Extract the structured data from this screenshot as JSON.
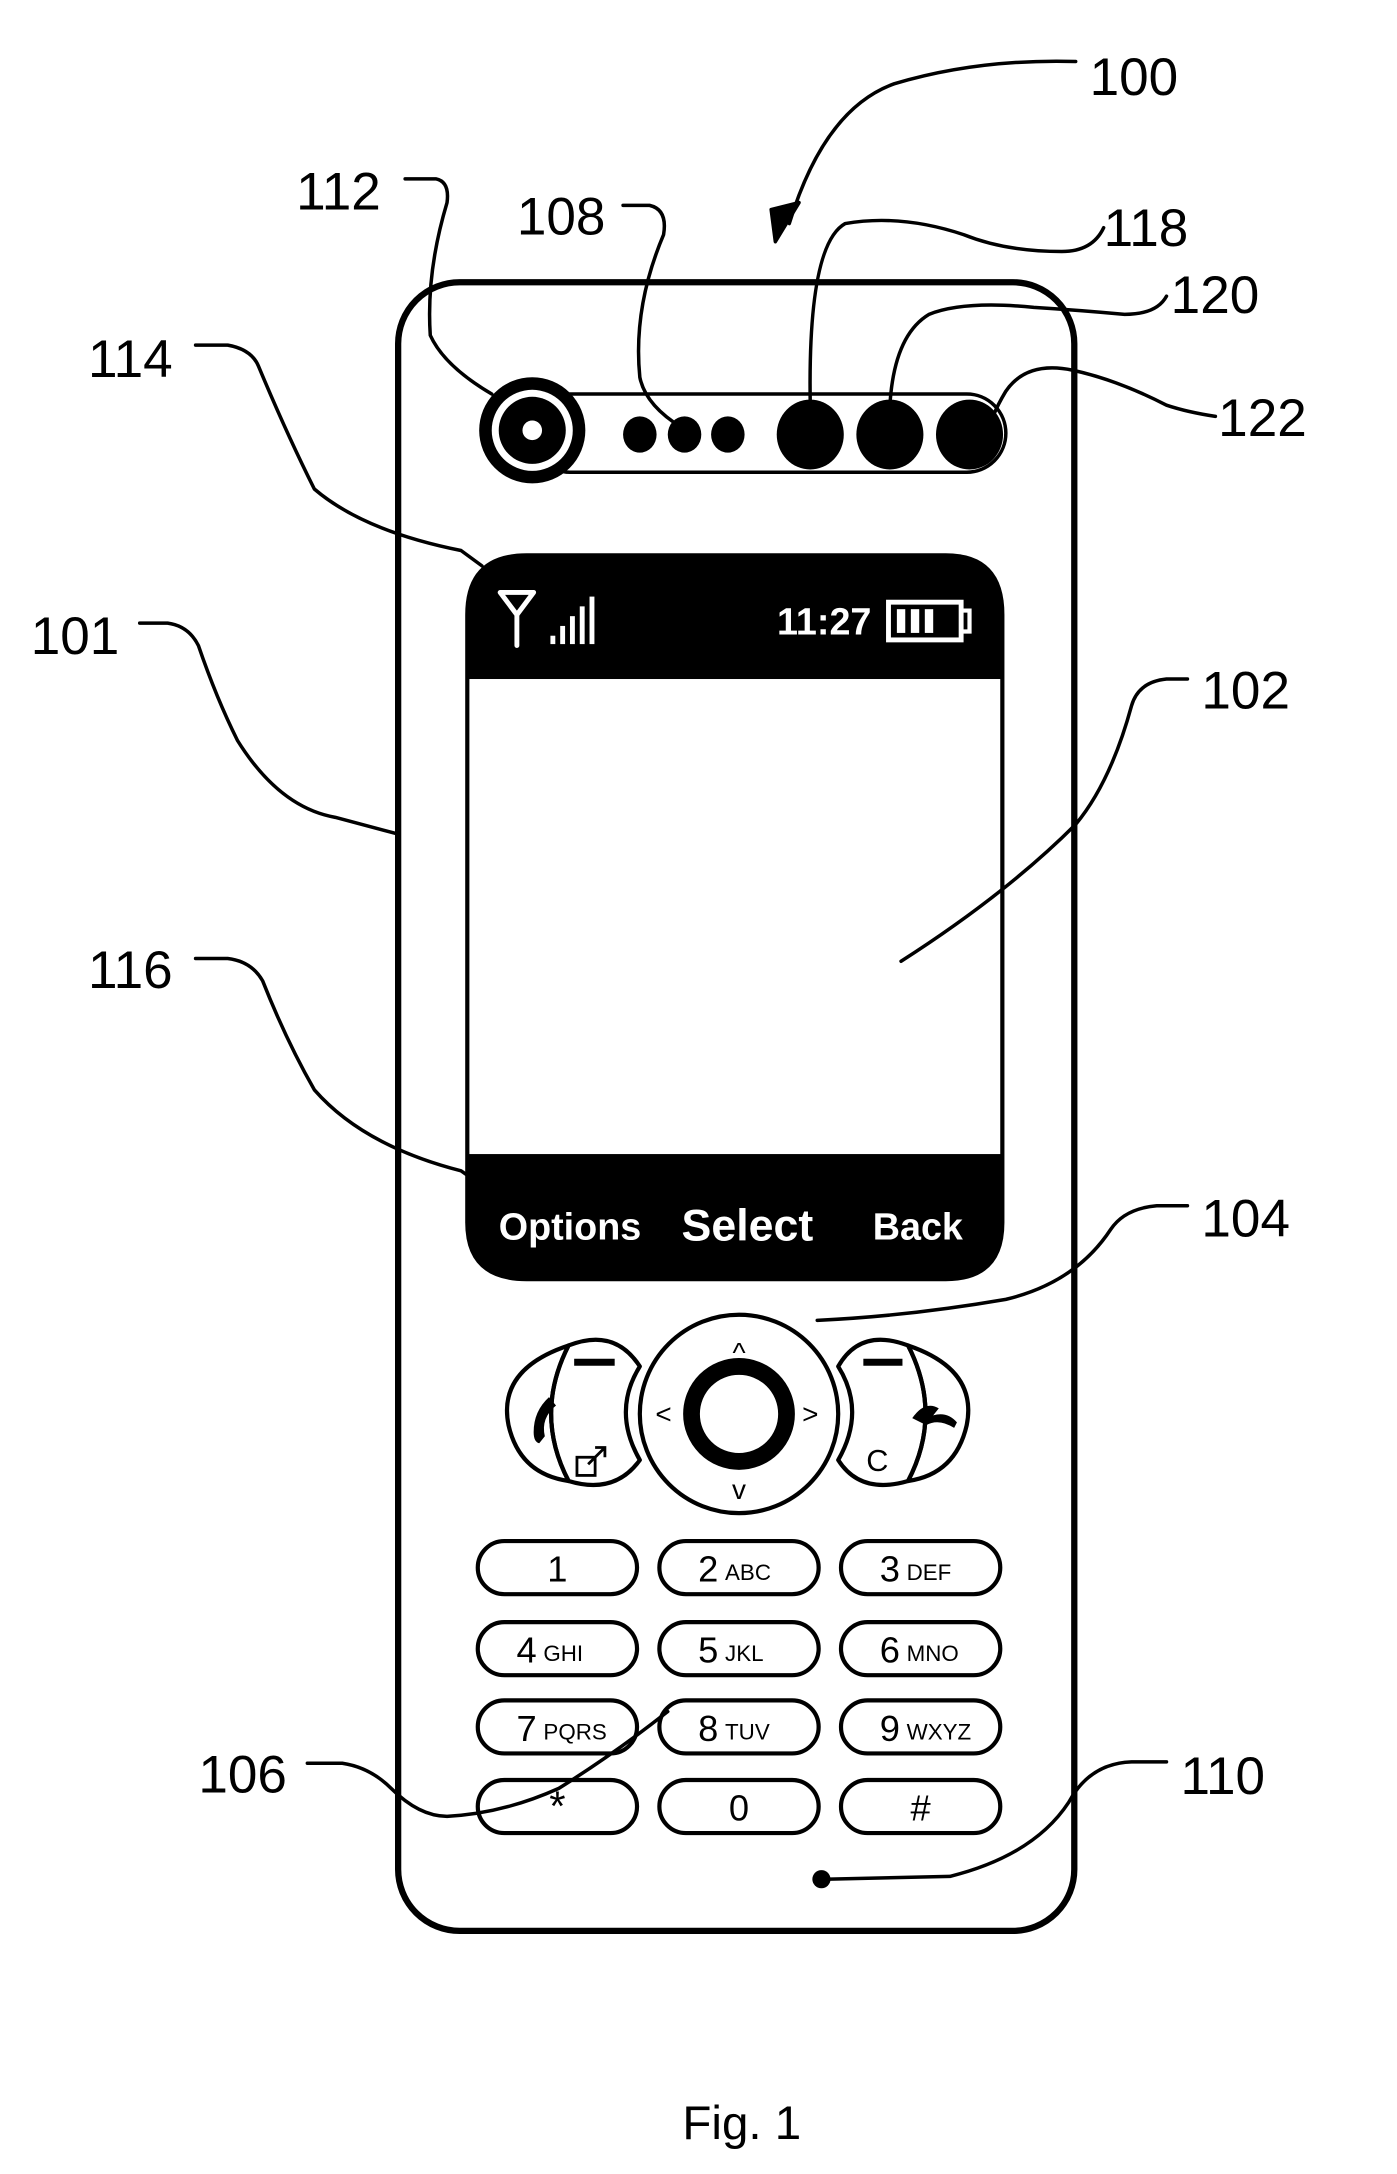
{
  "figure": {
    "caption": "Fig. 1",
    "reference_numerals": {
      "device": "100",
      "housing": "101",
      "display": "102",
      "navigation_key": "104",
      "keypad": "106",
      "speaker": "108",
      "microphone": "110",
      "camera": "112",
      "status_bar": "114",
      "softkey_bar": "116",
      "button_a": "118",
      "button_b": "120",
      "button_c": "122"
    }
  },
  "screen": {
    "status_bar": {
      "signal_icon": "antenna-signal-icon",
      "signal_bars": 5,
      "time": "11:27",
      "battery_icon": "battery-icon",
      "battery_bars": 3
    },
    "softkeys": {
      "left": "Options",
      "center": "Select",
      "right": "Back"
    }
  },
  "controls": {
    "call_key_icon": "phone-call-icon",
    "shortcut_icon": "external-link-icon",
    "left_softkey_mark": "—",
    "right_softkey_mark": "—",
    "clear_key_label": "C",
    "end_key_icon": "phone-hangup-icon",
    "nav": {
      "up": "^",
      "down": "v",
      "left": "<",
      "right": ">"
    }
  },
  "keypad": {
    "keys": [
      {
        "digit": "1",
        "letters": ""
      },
      {
        "digit": "2",
        "letters": "ABC"
      },
      {
        "digit": "3",
        "letters": "DEF"
      },
      {
        "digit": "4",
        "letters": "GHI"
      },
      {
        "digit": "5",
        "letters": "JKL"
      },
      {
        "digit": "6",
        "letters": "MNO"
      },
      {
        "digit": "7",
        "letters": "PQRS"
      },
      {
        "digit": "8",
        "letters": "TUV"
      },
      {
        "digit": "9",
        "letters": "WXYZ"
      },
      {
        "digit": "*",
        "letters": ""
      },
      {
        "digit": "0",
        "letters": ""
      },
      {
        "digit": "#",
        "letters": ""
      }
    ]
  }
}
